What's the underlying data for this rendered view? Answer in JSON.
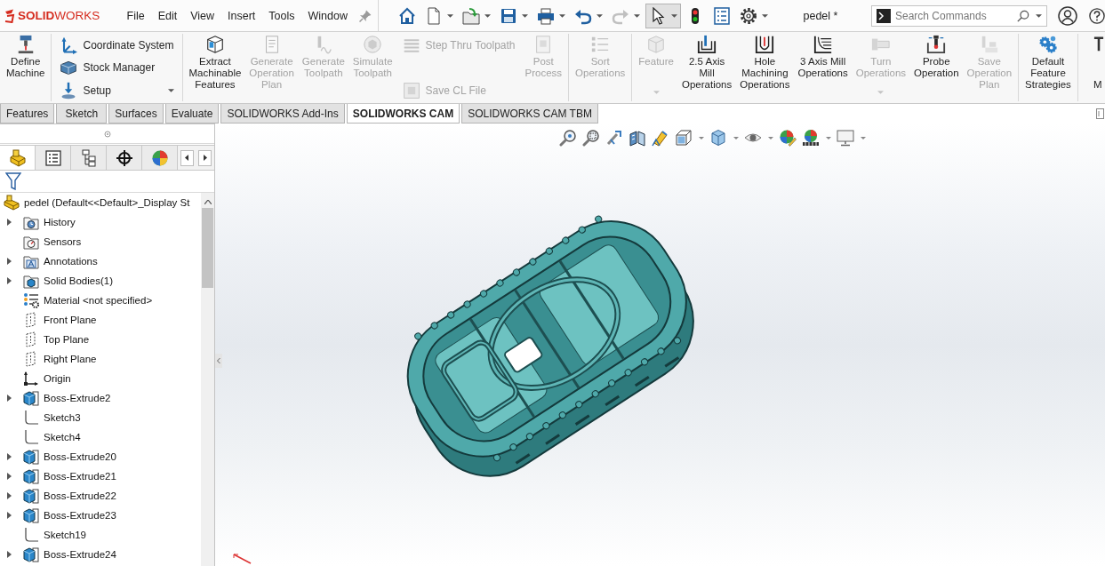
{
  "app": {
    "logo": "**SOLID**WORKS"
  },
  "menu": [
    "File",
    "Edit",
    "View",
    "Insert",
    "Tools",
    "Window"
  ],
  "quick_access": [
    {
      "kind": "home",
      "dropdown": false,
      "disabled": false,
      "pressed": false
    },
    {
      "kind": "new",
      "dropdown": true,
      "disabled": false,
      "pressed": false
    },
    {
      "kind": "open",
      "dropdown": true,
      "disabled": false,
      "pressed": false
    },
    {
      "kind": "save",
      "dropdown": true,
      "disabled": false,
      "pressed": false
    },
    {
      "kind": "print",
      "dropdown": true,
      "disabled": false,
      "pressed": false
    },
    {
      "kind": "undo",
      "dropdown": true,
      "disabled": false,
      "pressed": false
    },
    {
      "kind": "redo",
      "dropdown": true,
      "disabled": true,
      "pressed": false
    },
    {
      "kind": "select",
      "dropdown": true,
      "disabled": false,
      "pressed": true
    },
    {
      "kind": "rebuild",
      "dropdown": false,
      "disabled": false,
      "pressed": false
    },
    {
      "kind": "file_properties",
      "dropdown": false,
      "disabled": false,
      "pressed": false
    },
    {
      "kind": "options",
      "dropdown": true,
      "disabled": false,
      "pressed": false
    }
  ],
  "document_title": "pedel *",
  "search": {
    "placeholder": "Search Commands"
  },
  "ribbon": {
    "sections": [
      {
        "columns": [
          {
            "kind": "large",
            "label": "Define\nMachine",
            "disabled": false,
            "dropdown": false
          }
        ]
      },
      {
        "columns": [
          {
            "kind": "stack",
            "items": [
              {
                "label": "Coordinate System",
                "disabled": false,
                "dropdown": false
              },
              {
                "label": "Stock Manager",
                "disabled": false,
                "dropdown": false
              },
              {
                "label": "Setup",
                "disabled": false,
                "dropdown": true
              }
            ]
          }
        ]
      },
      {
        "columns": [
          {
            "kind": "large",
            "label": "Extract\nMachinable\nFeatures",
            "disabled": false,
            "dropdown": false
          },
          {
            "kind": "large",
            "label": "Generate\nOperation\nPlan",
            "disabled": true,
            "dropdown": false
          },
          {
            "kind": "large",
            "label": "Generate\nToolpath",
            "disabled": true,
            "dropdown": false
          },
          {
            "kind": "large",
            "label": "Simulate\nToolpath",
            "disabled": true,
            "dropdown": false
          },
          {
            "kind": "stack",
            "items": [
              {
                "label": "Step Thru Toolpath",
                "disabled": true,
                "dropdown": false
              },
              {
                "label": "Save CL File",
                "disabled": true,
                "dropdown": false
              }
            ]
          },
          {
            "kind": "large",
            "label": "Post\nProcess",
            "disabled": true,
            "dropdown": false
          }
        ]
      },
      {
        "columns": [
          {
            "kind": "large",
            "label": "Sort\nOperations",
            "disabled": true,
            "dropdown": false
          }
        ]
      },
      {
        "columns": [
          {
            "kind": "large",
            "label": "Feature",
            "disabled": true,
            "dropdown": true
          },
          {
            "kind": "large",
            "label": "2.5 Axis\nMill\nOperations",
            "disabled": false,
            "dropdown": false
          },
          {
            "kind": "large",
            "label": "Hole\nMachining\nOperations",
            "disabled": false,
            "dropdown": false
          },
          {
            "kind": "large",
            "label": "3 Axis Mill\nOperations",
            "disabled": false,
            "dropdown": false
          },
          {
            "kind": "large",
            "label": "Turn\nOperations",
            "disabled": true,
            "dropdown": true
          },
          {
            "kind": "large",
            "label": "Probe\nOperation",
            "disabled": false,
            "dropdown": false
          },
          {
            "kind": "large",
            "label": "Save\nOperation\nPlan",
            "disabled": true,
            "dropdown": false
          }
        ]
      },
      {
        "columns": [
          {
            "kind": "large",
            "label": "Default\nFeature\nStrategies",
            "disabled": false,
            "dropdown": false
          }
        ]
      },
      {
        "columns": [
          {
            "kind": "edge",
            "label": "M",
            "disabled": false,
            "dropdown": false
          }
        ]
      }
    ]
  },
  "command_tabs": [
    {
      "label": "Features",
      "selected": false
    },
    {
      "label": "Sketch",
      "selected": false
    },
    {
      "label": "Surfaces",
      "selected": false
    },
    {
      "label": "Evaluate",
      "selected": false
    },
    {
      "label": "SOLIDWORKS Add-Ins",
      "selected": false
    },
    {
      "label": "SOLIDWORKS CAM",
      "selected": true
    },
    {
      "label": "SOLIDWORKS CAM TBM",
      "selected": false
    }
  ],
  "feature_manager": {
    "tabs": [
      {
        "kind": "feature_tree",
        "selected": true
      },
      {
        "kind": "property",
        "selected": false
      },
      {
        "kind": "configuration",
        "selected": false
      },
      {
        "kind": "dimxpert",
        "selected": false
      },
      {
        "kind": "display",
        "selected": false
      }
    ],
    "tree": {
      "label": "pedel (Default<<Default>_Display St",
      "kind": "part",
      "children": [
        {
          "label": "History",
          "kind": "history",
          "expandable": true
        },
        {
          "label": "Sensors",
          "kind": "sensors",
          "expandable": false
        },
        {
          "label": "Annotations",
          "kind": "annotations",
          "expandable": true
        },
        {
          "label": "Solid Bodies(1)",
          "kind": "bodies",
          "expandable": true
        },
        {
          "label": "Material <not specified>",
          "kind": "material",
          "expandable": false
        },
        {
          "label": "Front Plane",
          "kind": "plane",
          "expandable": false
        },
        {
          "label": "Top Plane",
          "kind": "plane",
          "expandable": false
        },
        {
          "label": "Right Plane",
          "kind": "plane",
          "expandable": false
        },
        {
          "label": "Origin",
          "kind": "origin",
          "expandable": false
        },
        {
          "label": "Boss-Extrude2",
          "kind": "extrude",
          "expandable": true
        },
        {
          "label": "Sketch3",
          "kind": "sketch",
          "expandable": false
        },
        {
          "label": "Sketch4",
          "kind": "sketch",
          "expandable": false
        },
        {
          "label": "Boss-Extrude20",
          "kind": "extrude",
          "expandable": true
        },
        {
          "label": "Boss-Extrude21",
          "kind": "extrude",
          "expandable": true
        },
        {
          "label": "Boss-Extrude22",
          "kind": "extrude",
          "expandable": true
        },
        {
          "label": "Boss-Extrude23",
          "kind": "extrude",
          "expandable": true
        },
        {
          "label": "Sketch19",
          "kind": "sketch",
          "expandable": false
        },
        {
          "label": "Boss-Extrude24",
          "kind": "extrude",
          "expandable": true
        }
      ]
    }
  },
  "view_toolbar": [
    {
      "kind": "zoom_fit",
      "dropdown": false
    },
    {
      "kind": "zoom_area",
      "dropdown": false
    },
    {
      "kind": "previous",
      "dropdown": false
    },
    {
      "kind": "section",
      "dropdown": false
    },
    {
      "kind": "dynamic_annotation",
      "dropdown": false
    },
    {
      "kind": "orientation",
      "dropdown": true
    },
    {
      "kind": "display_style",
      "dropdown": true
    },
    {
      "kind": "hide_show",
      "dropdown": true
    },
    {
      "kind": "appearance",
      "dropdown": false
    },
    {
      "kind": "scene",
      "dropdown": true
    },
    {
      "kind": "view_settings",
      "dropdown": true
    }
  ]
}
